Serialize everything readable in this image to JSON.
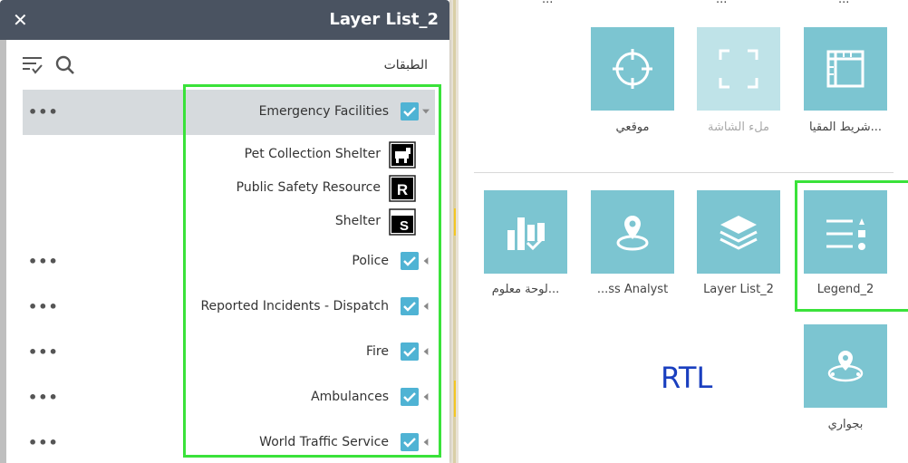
{
  "panel": {
    "title": "Layer List_2",
    "layers_label": "الطبقات",
    "rows": [
      {
        "label": "Emergency Facilities"
      },
      {
        "label": "Police"
      },
      {
        "label": "Reported Incidents - Dispatch"
      },
      {
        "label": "Fire"
      },
      {
        "label": "Ambulances"
      },
      {
        "label": "World Traffic Service"
      }
    ],
    "legend_items": [
      {
        "label": "Pet Collection Shelter",
        "symbol": "pet-icon"
      },
      {
        "label": "Public Safety Resource",
        "symbol": "resource-r-icon"
      },
      {
        "label": "Shelter",
        "symbol": "shelter-s-icon"
      }
    ],
    "more_label": "•••"
  },
  "widgets": {
    "top_cut": [
      "...",
      "...",
      "..."
    ],
    "row1": [
      {
        "label": "شريط المقيا...",
        "icon": "scalebar-icon"
      },
      {
        "label": "ملء الشاشة",
        "icon": "fullscreen-icon"
      },
      {
        "label": "موقعي",
        "icon": "my-location-icon"
      }
    ],
    "row2": [
      {
        "label": "Legend_2",
        "icon": "legend-icon"
      },
      {
        "label": "Layer List_2",
        "icon": "layers-icon"
      },
      {
        "label": "...ss Analyst",
        "icon": "business-analyst-icon"
      },
      {
        "label": "لوحة معلوم...",
        "icon": "infographic-icon"
      }
    ],
    "row3": [
      {
        "label": "بجواري",
        "icon": "near-me-icon"
      }
    ]
  },
  "annotation": {
    "rtl": "RTL"
  },
  "colors": {
    "header": "#4a5361",
    "tile": "#7cc5d1",
    "checkbox": "#4fb3d4",
    "highlight": "#3ae23a"
  }
}
